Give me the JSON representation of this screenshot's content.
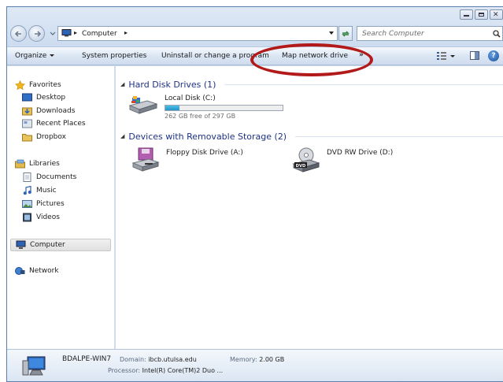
{
  "address": {
    "path": "Computer",
    "search_placeholder": "Search Computer"
  },
  "toolbar": {
    "organize": "Organize",
    "system_properties": "System properties",
    "uninstall": "Uninstall or change a program",
    "map_network": "Map network drive",
    "overflow": "»"
  },
  "nav": {
    "favorites": "Favorites",
    "desktop": "Desktop",
    "downloads": "Downloads",
    "recent": "Recent Places",
    "dropbox": "Dropbox",
    "libraries": "Libraries",
    "documents": "Documents",
    "music": "Music",
    "pictures": "Pictures",
    "videos": "Videos",
    "computer": "Computer",
    "network": "Network"
  },
  "content": {
    "hdd_group": "Hard Disk Drives (1)",
    "local_disk": "Local Disk (C:)",
    "local_free": "262 GB free of 297 GB",
    "local_used_fraction": 0.12,
    "removable_group": "Devices with Removable Storage (2)",
    "floppy": "Floppy Disk Drive (A:)",
    "dvd": "DVD RW Drive (D:)",
    "dvd_badge": "DVD"
  },
  "details": {
    "computer_name": "BDALPE-WIN7",
    "domain_label": "Domain:",
    "domain_value": "ibcb.utulsa.edu",
    "memory_label": "Memory:",
    "memory_value": "2.00 GB",
    "processor_label": "Processor:",
    "processor_value": "Intel(R) Core(TM)2 Duo ..."
  },
  "colors": {
    "annotation": "#b21a1a",
    "group_header": "#1e3287",
    "usage_bar": "#2692c8"
  }
}
